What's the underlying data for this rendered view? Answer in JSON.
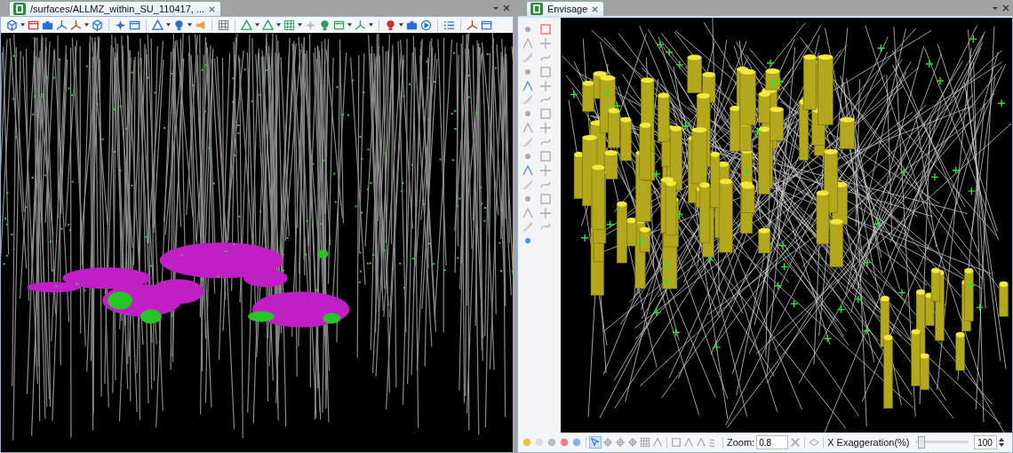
{
  "left_view": {
    "title": "/surfaces/ALLMZ_within_SU_110417, ..."
  },
  "right_view": {
    "title": "Envisage",
    "zoom_label": "Zoom:",
    "zoom_value": "0.8",
    "exaggeration_label": "X Exaggeration(%)",
    "exaggeration_slider": {
      "level": 0.05
    },
    "exaggeration_value": "100"
  }
}
